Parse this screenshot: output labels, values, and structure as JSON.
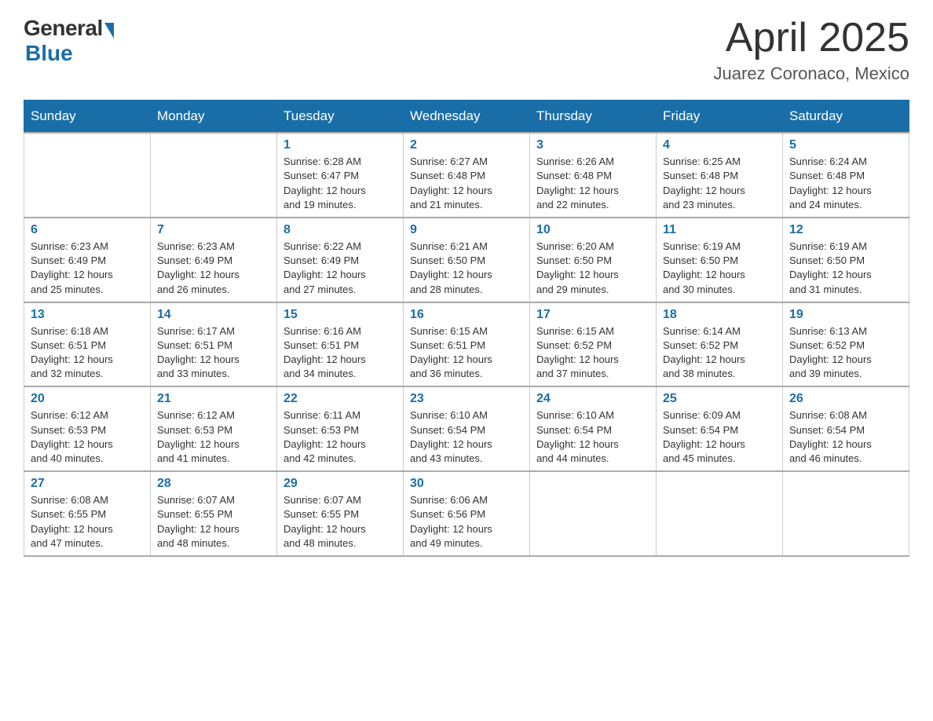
{
  "header": {
    "logo": {
      "general": "General",
      "blue": "Blue"
    },
    "title": "April 2025",
    "location": "Juarez Coronaco, Mexico"
  },
  "calendar": {
    "days_of_week": [
      "Sunday",
      "Monday",
      "Tuesday",
      "Wednesday",
      "Thursday",
      "Friday",
      "Saturday"
    ],
    "weeks": [
      [
        {
          "day": "",
          "info": ""
        },
        {
          "day": "",
          "info": ""
        },
        {
          "day": "1",
          "info": "Sunrise: 6:28 AM\nSunset: 6:47 PM\nDaylight: 12 hours\nand 19 minutes."
        },
        {
          "day": "2",
          "info": "Sunrise: 6:27 AM\nSunset: 6:48 PM\nDaylight: 12 hours\nand 21 minutes."
        },
        {
          "day": "3",
          "info": "Sunrise: 6:26 AM\nSunset: 6:48 PM\nDaylight: 12 hours\nand 22 minutes."
        },
        {
          "day": "4",
          "info": "Sunrise: 6:25 AM\nSunset: 6:48 PM\nDaylight: 12 hours\nand 23 minutes."
        },
        {
          "day": "5",
          "info": "Sunrise: 6:24 AM\nSunset: 6:48 PM\nDaylight: 12 hours\nand 24 minutes."
        }
      ],
      [
        {
          "day": "6",
          "info": "Sunrise: 6:23 AM\nSunset: 6:49 PM\nDaylight: 12 hours\nand 25 minutes."
        },
        {
          "day": "7",
          "info": "Sunrise: 6:23 AM\nSunset: 6:49 PM\nDaylight: 12 hours\nand 26 minutes."
        },
        {
          "day": "8",
          "info": "Sunrise: 6:22 AM\nSunset: 6:49 PM\nDaylight: 12 hours\nand 27 minutes."
        },
        {
          "day": "9",
          "info": "Sunrise: 6:21 AM\nSunset: 6:50 PM\nDaylight: 12 hours\nand 28 minutes."
        },
        {
          "day": "10",
          "info": "Sunrise: 6:20 AM\nSunset: 6:50 PM\nDaylight: 12 hours\nand 29 minutes."
        },
        {
          "day": "11",
          "info": "Sunrise: 6:19 AM\nSunset: 6:50 PM\nDaylight: 12 hours\nand 30 minutes."
        },
        {
          "day": "12",
          "info": "Sunrise: 6:19 AM\nSunset: 6:50 PM\nDaylight: 12 hours\nand 31 minutes."
        }
      ],
      [
        {
          "day": "13",
          "info": "Sunrise: 6:18 AM\nSunset: 6:51 PM\nDaylight: 12 hours\nand 32 minutes."
        },
        {
          "day": "14",
          "info": "Sunrise: 6:17 AM\nSunset: 6:51 PM\nDaylight: 12 hours\nand 33 minutes."
        },
        {
          "day": "15",
          "info": "Sunrise: 6:16 AM\nSunset: 6:51 PM\nDaylight: 12 hours\nand 34 minutes."
        },
        {
          "day": "16",
          "info": "Sunrise: 6:15 AM\nSunset: 6:51 PM\nDaylight: 12 hours\nand 36 minutes."
        },
        {
          "day": "17",
          "info": "Sunrise: 6:15 AM\nSunset: 6:52 PM\nDaylight: 12 hours\nand 37 minutes."
        },
        {
          "day": "18",
          "info": "Sunrise: 6:14 AM\nSunset: 6:52 PM\nDaylight: 12 hours\nand 38 minutes."
        },
        {
          "day": "19",
          "info": "Sunrise: 6:13 AM\nSunset: 6:52 PM\nDaylight: 12 hours\nand 39 minutes."
        }
      ],
      [
        {
          "day": "20",
          "info": "Sunrise: 6:12 AM\nSunset: 6:53 PM\nDaylight: 12 hours\nand 40 minutes."
        },
        {
          "day": "21",
          "info": "Sunrise: 6:12 AM\nSunset: 6:53 PM\nDaylight: 12 hours\nand 41 minutes."
        },
        {
          "day": "22",
          "info": "Sunrise: 6:11 AM\nSunset: 6:53 PM\nDaylight: 12 hours\nand 42 minutes."
        },
        {
          "day": "23",
          "info": "Sunrise: 6:10 AM\nSunset: 6:54 PM\nDaylight: 12 hours\nand 43 minutes."
        },
        {
          "day": "24",
          "info": "Sunrise: 6:10 AM\nSunset: 6:54 PM\nDaylight: 12 hours\nand 44 minutes."
        },
        {
          "day": "25",
          "info": "Sunrise: 6:09 AM\nSunset: 6:54 PM\nDaylight: 12 hours\nand 45 minutes."
        },
        {
          "day": "26",
          "info": "Sunrise: 6:08 AM\nSunset: 6:54 PM\nDaylight: 12 hours\nand 46 minutes."
        }
      ],
      [
        {
          "day": "27",
          "info": "Sunrise: 6:08 AM\nSunset: 6:55 PM\nDaylight: 12 hours\nand 47 minutes."
        },
        {
          "day": "28",
          "info": "Sunrise: 6:07 AM\nSunset: 6:55 PM\nDaylight: 12 hours\nand 48 minutes."
        },
        {
          "day": "29",
          "info": "Sunrise: 6:07 AM\nSunset: 6:55 PM\nDaylight: 12 hours\nand 48 minutes."
        },
        {
          "day": "30",
          "info": "Sunrise: 6:06 AM\nSunset: 6:56 PM\nDaylight: 12 hours\nand 49 minutes."
        },
        {
          "day": "",
          "info": ""
        },
        {
          "day": "",
          "info": ""
        },
        {
          "day": "",
          "info": ""
        }
      ]
    ]
  }
}
